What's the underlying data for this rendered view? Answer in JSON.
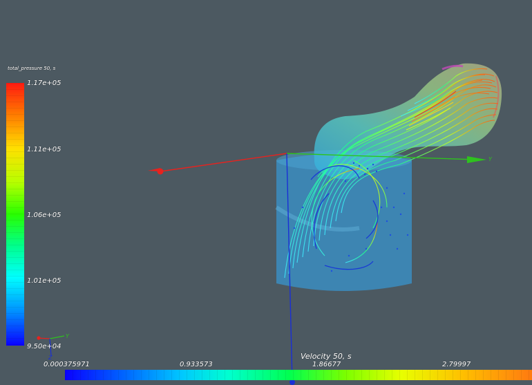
{
  "pressure_legend": {
    "title": "total_pressure 50, s",
    "ticks": [
      "1.17e+05",
      "1.11e+05",
      "1.06e+05",
      "1.01e+05",
      "9.50e+04"
    ]
  },
  "velocity_legend": {
    "title": "Velocity 50, s",
    "ticks": [
      "0.000375971",
      "0.933573",
      "1.86677",
      "2.79997"
    ]
  },
  "axes": {
    "scene_y": "Y",
    "triad_y": "Y",
    "triad_z": "Z"
  },
  "colors": {
    "background": "#4c5961",
    "x_axis": "#e8221e",
    "y_axis": "#2ec21e",
    "z_axis": "#1a2fd6",
    "cylinder": "#3a8fc4"
  }
}
